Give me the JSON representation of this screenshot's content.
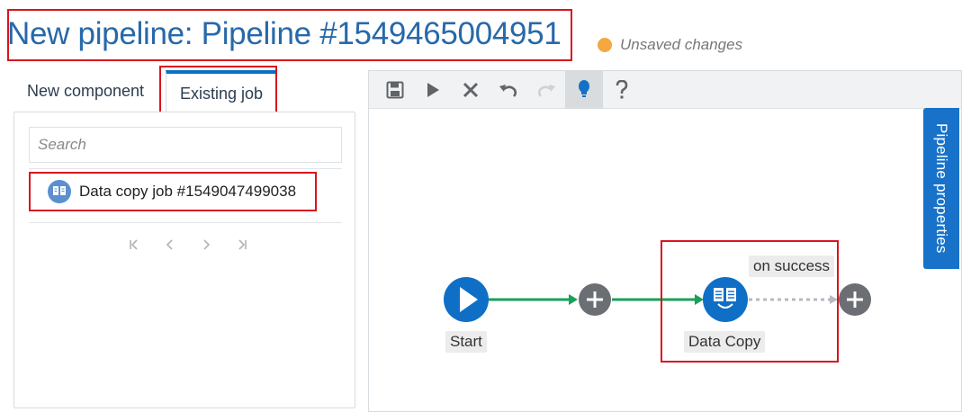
{
  "header": {
    "title": "New pipeline:  Pipeline #1549465004951",
    "status_text": "Unsaved changes",
    "status_color": "#f5a742"
  },
  "tabs": {
    "new_component": "New component",
    "existing_job": "Existing job"
  },
  "left_panel": {
    "search_placeholder": "Search",
    "jobs": [
      {
        "label": "Data copy job #1549047499038",
        "icon": "data-copy-icon"
      }
    ],
    "pager": [
      "first-page-icon",
      "prev-page-icon",
      "next-page-icon",
      "last-page-icon"
    ]
  },
  "toolbar": {
    "tools": [
      "save-icon",
      "run-icon",
      "delete-icon",
      "undo-icon",
      "redo-icon",
      "hint-icon",
      "help-icon"
    ],
    "active": "hint-icon"
  },
  "side_tab": {
    "label": "Pipeline properties"
  },
  "flow": {
    "start_label": "Start",
    "data_copy_label": "Data Copy",
    "on_success_label": "on success",
    "accent": "#0f6fc6",
    "link_color": "#1aa05a",
    "add_color": "#6b6e72"
  }
}
